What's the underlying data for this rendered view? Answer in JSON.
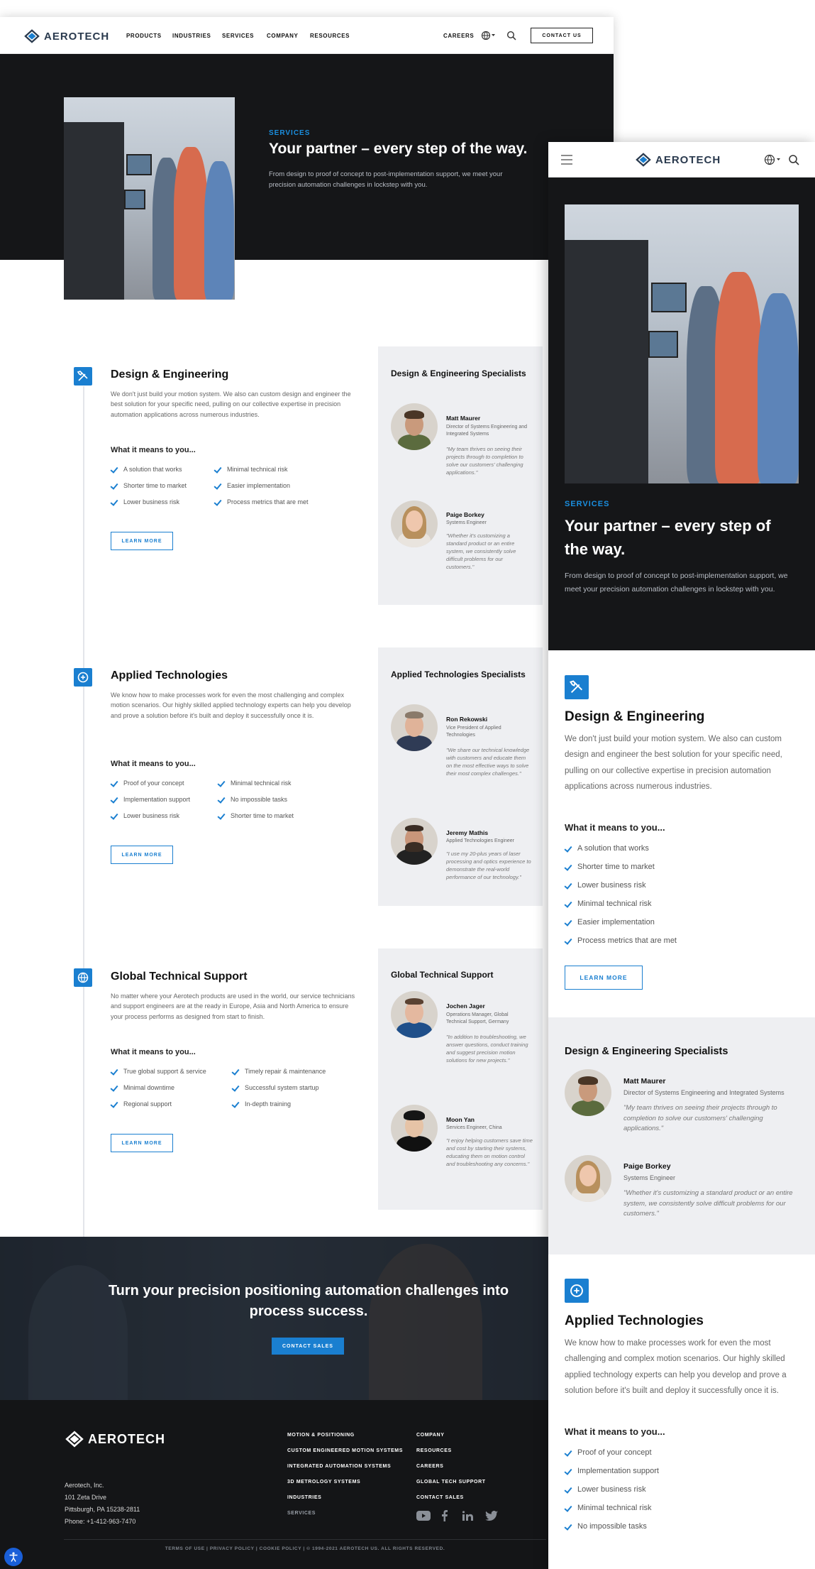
{
  "brand": "AEROTECH",
  "nav": [
    "PRODUCTS",
    "INDUSTRIES",
    "SERVICES",
    "COMPANY",
    "RESOURCES"
  ],
  "header": {
    "careers": "CAREERS",
    "contact": "CONTACT US"
  },
  "hero": {
    "eyebrow": "SERVICES",
    "title": "Your partner – every step of the way.",
    "subtitle": "From design to proof of concept to post-implementation support, we meet your precision automation challenges in lockstep with you."
  },
  "sections": [
    {
      "title": "Design & Engineering",
      "desc": "We don't just build your motion system. We also can custom design and engineer the best solution for your specific need, pulling on our collective expertise in precision automation applications across numerous industries.",
      "means": "What it means to you...",
      "bullets": [
        "A solution that works",
        "Shorter time to market",
        "Lower business risk",
        "Minimal technical risk",
        "Easier implementation",
        "Process metrics that are met"
      ],
      "cta": "LEARN MORE",
      "panel_title": "Design & Engineering Specialists",
      "people": [
        {
          "name": "Matt Maurer",
          "role": "Director of Systems Engineering and Integrated Systems",
          "quote": "\"My team thrives on seeing their projects through to completion to solve our customers' challenging applications.\""
        },
        {
          "name": "Paige Borkey",
          "role": "Systems Engineer",
          "quote": "\"Whether it's customizing a standard product or an entire system, we consistently solve difficult problems for our customers.\""
        }
      ]
    },
    {
      "title": "Applied Technologies",
      "desc": "We know how to make processes work for even the most challenging and complex motion scenarios. Our highly skilled applied technology experts can help you develop and prove a solution before it's built and deploy it successfully once it is.",
      "means": "What it means to you...",
      "bullets": [
        "Proof of your concept",
        "Implementation support",
        "Lower business risk",
        "Minimal technical risk",
        "No impossible tasks",
        "Shorter time to market"
      ],
      "cta": "LEARN MORE",
      "panel_title": "Applied Technologies Specialists",
      "people": [
        {
          "name": "Ron Rekowski",
          "role": "Vice President of Applied Technologies",
          "quote": "\"We share our technical knowledge with customers and educate them on the most effective ways to solve their most complex challenges.\""
        },
        {
          "name": "Jeremy Mathis",
          "role": "Applied Technologies Engineer",
          "quote": "\"I use my 20-plus years of laser processing and optics experience to demonstrate the real-world performance of our technology.\""
        }
      ]
    },
    {
      "title": "Global Technical Support",
      "desc": "No matter where your Aerotech products are used in the world, our service technicians and support engineers are at the ready in Europe, Asia and North America to ensure your process performs as designed from start to finish.",
      "means": "What it means to you...",
      "bullets": [
        "True global support & service",
        "Minimal downtime",
        "Regional support",
        "Timely repair & maintenance",
        "Successful system startup",
        "In-depth training"
      ],
      "cta": "LEARN MORE",
      "panel_title": "Global Technical Support",
      "people": [
        {
          "name": "Jochen Jager",
          "role": "Operations Manager, Global Technical Support, Germany",
          "quote": "\"In addition to troubleshooting, we answer questions, conduct training and suggest precision motion solutions for new projects.\""
        },
        {
          "name": "Moon Yan",
          "role": "Services Engineer, China",
          "quote": "\"I enjoy helping customers save time and cost by starting their systems, educating them on motion control and troubleshooting any concerns.\""
        }
      ]
    }
  ],
  "cta_band": {
    "title": "Turn your precision positioning automation challenges into process success.",
    "button": "CONTACT SALES"
  },
  "footer": {
    "address": [
      "Aerotech, Inc.",
      "101 Zeta Drive",
      "Pittsburgh, PA 15238-2811",
      "Phone: +1-412-963-7470"
    ],
    "col1": [
      "MOTION & POSITIONING",
      "CUSTOM ENGINEERED MOTION SYSTEMS",
      "INTEGRATED AUTOMATION SYSTEMS",
      "3D METROLOGY SYSTEMS",
      "INDUSTRIES",
      "SERVICES"
    ],
    "col2": [
      "COMPANY",
      "RESOURCES",
      "CAREERS",
      "GLOBAL TECH SUPPORT",
      "CONTACT SALES"
    ],
    "legal": "TERMS OF USE | PRIVACY POLICY | COOKIE POLICY | © 1994-2021 AEROTECH US. ALL RIGHTS RESERVED."
  },
  "colors": {
    "accent": "#1a7fd0",
    "dark": "#151618",
    "panel": "#eeeff2"
  }
}
